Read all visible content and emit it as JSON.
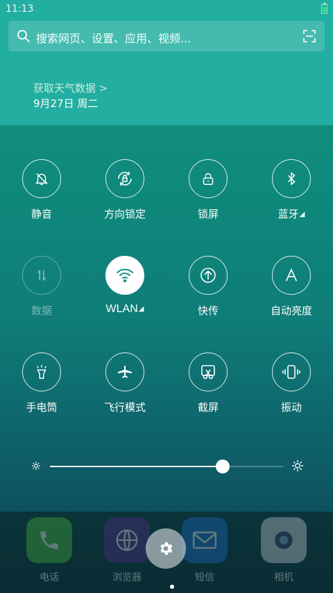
{
  "status_bar": {
    "time": "11:13"
  },
  "search": {
    "placeholder": "搜索网页、设置、应用、视频..."
  },
  "weather": {
    "link_text": "获取天气数据 >",
    "date": "9月27日 周二"
  },
  "toggles": [
    {
      "label": "静音",
      "icon": "mute-bell-icon",
      "state": "off"
    },
    {
      "label": "方向锁定",
      "icon": "rotation-lock-icon",
      "state": "off"
    },
    {
      "label": "锁屏",
      "icon": "lock-icon",
      "state": "off"
    },
    {
      "label": "蓝牙",
      "icon": "bluetooth-icon",
      "state": "off",
      "more": "◢"
    },
    {
      "label": "数据",
      "icon": "mobile-data-icon",
      "state": "disabled"
    },
    {
      "label": "WLAN",
      "icon": "wifi-icon",
      "state": "on",
      "more": "◢"
    },
    {
      "label": "快传",
      "icon": "quick-transfer-icon",
      "state": "off"
    },
    {
      "label": "自动亮度",
      "icon": "auto-brightness-icon",
      "state": "off"
    },
    {
      "label": "手电筒",
      "icon": "flashlight-icon",
      "state": "off"
    },
    {
      "label": "飞行模式",
      "icon": "airplane-icon",
      "state": "off"
    },
    {
      "label": "截屏",
      "icon": "screenshot-icon",
      "state": "off"
    },
    {
      "label": "振动",
      "icon": "vibrate-icon",
      "state": "off"
    }
  ],
  "brightness": {
    "level": 0.74
  },
  "dock": {
    "apps": [
      {
        "label": "电话",
        "icon": "phone-icon",
        "color": "#4cbf3a"
      },
      {
        "label": "浏览器",
        "icon": "browser-icon",
        "color": "#5b2b8c"
      },
      {
        "label": "短信",
        "icon": "message-icon",
        "color": "#1f6fd1"
      },
      {
        "label": "相机",
        "icon": "camera-icon",
        "color": "#d9d9df"
      }
    ]
  },
  "colors": {
    "panel": "#22aea0",
    "accent": "#ffffff"
  }
}
